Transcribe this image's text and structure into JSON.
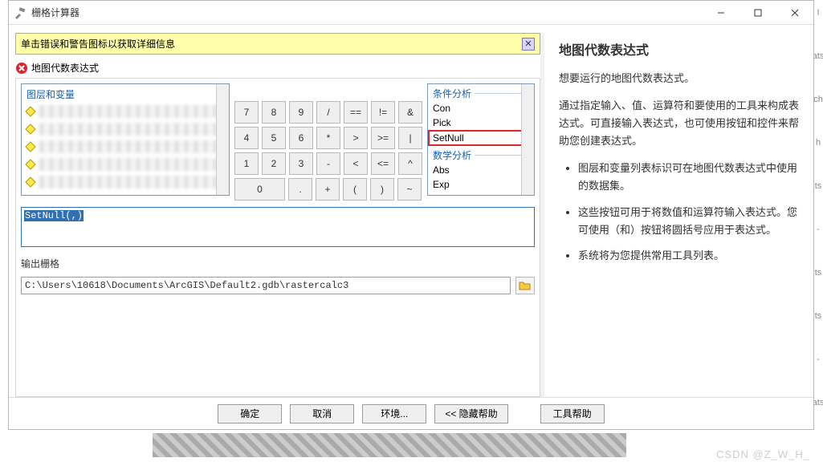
{
  "window": {
    "title": "栅格计算器"
  },
  "notice": {
    "text": "单击错误和警告图标以获取详细信息"
  },
  "error_row": {
    "text": "地图代数表达式"
  },
  "layers": {
    "head": "图层和变量"
  },
  "calc": {
    "r1": [
      "7",
      "8",
      "9",
      "/",
      "==",
      "!=",
      "&"
    ],
    "r2": [
      "4",
      "5",
      "6",
      "*",
      ">",
      ">=",
      "|"
    ],
    "r3": [
      "1",
      "2",
      "3",
      "-",
      "<",
      "<=",
      "^"
    ],
    "r4": [
      "0",
      ".",
      "+",
      "(",
      ")",
      "~"
    ]
  },
  "tools": {
    "head1": "条件分析",
    "items1": [
      "Con",
      "Pick",
      "SetNull"
    ],
    "head2": "数学分析",
    "items2": [
      "Abs",
      "Exp"
    ]
  },
  "expression": {
    "value": "SetNull(,)"
  },
  "output": {
    "label": "输出栅格",
    "path": "C:\\Users\\10618\\Documents\\ArcGIS\\Default2.gdb\\rastercalc3"
  },
  "footer": {
    "ok": "确定",
    "cancel": "取消",
    "env": "环境...",
    "hidehelp": "<< 隐藏帮助",
    "toolhelp": "工具帮助"
  },
  "help": {
    "title": "地图代数表达式",
    "p1": "想要运行的地图代数表达式。",
    "p2": "通过指定输入、值、运算符和要使用的工具来构成表达式。可直接输入表达式，也可使用按钮和控件来帮助您创建表达式。",
    "li1": "图层和变量列表标识可在地图代数表达式中使用的数据集。",
    "li2": "这些按钮可用于将数值和运算符输入表达式。您可使用（和）按钮将圆括号应用于表达式。",
    "li3": "系统将为您提供常用工具列表。"
  },
  "watermark": "CSDN @Z_W_H_"
}
